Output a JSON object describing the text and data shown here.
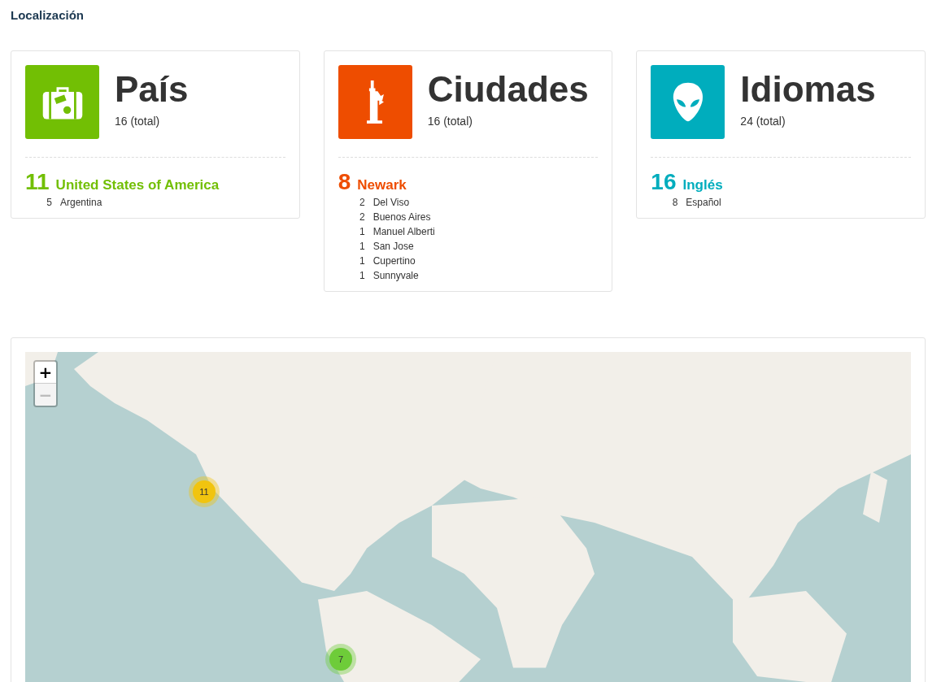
{
  "page_title": "Localización",
  "cards": [
    {
      "kind": "suitcase",
      "color": "#72bf04",
      "title": "País",
      "total": "16 (total)",
      "top": {
        "count": "11",
        "name": "United States of America"
      },
      "items": [
        {
          "count": "5",
          "name": "Argentina"
        }
      ]
    },
    {
      "kind": "statue",
      "color": "#ee4d00",
      "title": "Ciudades",
      "total": "16 (total)",
      "top": {
        "count": "8",
        "name": "Newark"
      },
      "items": [
        {
          "count": "2",
          "name": "Del Viso"
        },
        {
          "count": "2",
          "name": "Buenos Aires"
        },
        {
          "count": "1",
          "name": "Manuel Alberti"
        },
        {
          "count": "1",
          "name": "San Jose"
        },
        {
          "count": "1",
          "name": "Cupertino"
        },
        {
          "count": "1",
          "name": "Sunnyvale"
        }
      ]
    },
    {
      "kind": "alien",
      "color": "#00adbd",
      "title": "Idiomas",
      "total": "24 (total)",
      "top": {
        "count": "16",
        "name": "Inglés"
      },
      "items": [
        {
          "count": "8",
          "name": "Español"
        }
      ]
    }
  ],
  "map": {
    "zoom_controls": [
      {
        "label": "+",
        "disabled": false
      },
      {
        "label": "−",
        "disabled": true
      }
    ],
    "clusters": [
      {
        "count": "11",
        "color": "#f1c40f"
      },
      {
        "count": "7",
        "color": "#6ecc39"
      }
    ]
  }
}
